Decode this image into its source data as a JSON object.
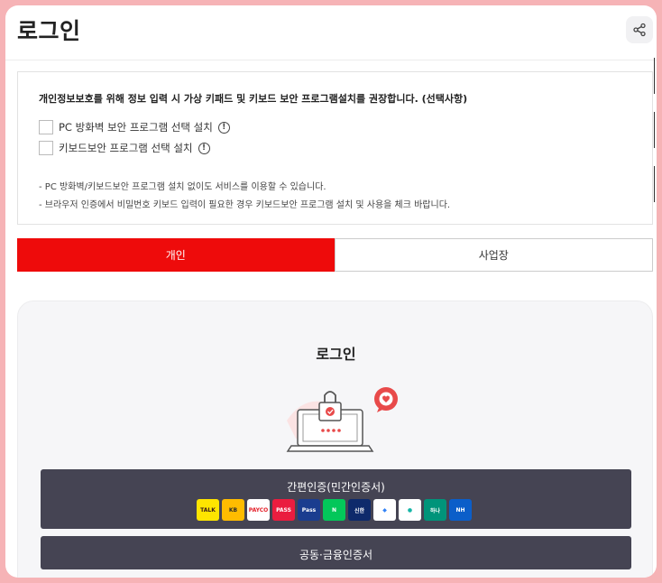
{
  "header": {
    "title": "로그인",
    "share_icon": "share-icon"
  },
  "security_notice": {
    "title": "개인정보보호를 위해 정보 입력 시 가상 키패드 및 키보드 보안 프로그램설치를 권장합니다. (선택사항)",
    "options": [
      {
        "label": "PC 방화벽 보안 프로그램 선택 설치",
        "checked": false
      },
      {
        "label": "키보드보안 프로그램 선택 설치",
        "checked": false
      }
    ],
    "notes": [
      "- PC 방화벽/키보드보안 프로그램 설치 없이도 서비스를 이용할 수 있습니다.",
      "- 브라우저 인증에서 비밀번호 키보드 입력이 필요한 경우 키보드보안 프로그램 설치 및 사용을 체크 바랍니다."
    ],
    "info_icon_glyph": "!"
  },
  "tabs": [
    {
      "label": "개인",
      "active": true
    },
    {
      "label": "사업장",
      "active": false
    }
  ],
  "login_panel": {
    "title": "로그인",
    "illustration": "laptop-lock-icon",
    "simple_auth_label": "간편인증(민간인증서)",
    "cert_login_label": "공동·금융인증서",
    "providers": [
      {
        "name": "kakao",
        "text": "TALK",
        "bg": "#fee500",
        "fg": "#3a1d1d"
      },
      {
        "name": "kb",
        "text": "KB",
        "bg": "#ffbc00",
        "fg": "#2b2b2b"
      },
      {
        "name": "payco",
        "text": "PAYCO",
        "bg": "#ffffff",
        "fg": "#e4212b"
      },
      {
        "name": "pass",
        "text": "PASS",
        "bg": "#ea1d3f",
        "fg": "#ffffff"
      },
      {
        "name": "samsung-pass",
        "text": "Pass",
        "bg": "#1a3d8f",
        "fg": "#ffffff"
      },
      {
        "name": "naver",
        "text": "N",
        "bg": "#03c75a",
        "fg": "#ffffff"
      },
      {
        "name": "shinhan",
        "text": "신한",
        "bg": "#0e2a6b",
        "fg": "#ffffff"
      },
      {
        "name": "toss",
        "text": "◆",
        "bg": "#ffffff",
        "fg": "#3182f6"
      },
      {
        "name": "bank-salad",
        "text": "●",
        "bg": "#ffffff",
        "fg": "#16b5a6"
      },
      {
        "name": "hana",
        "text": "하나",
        "bg": "#00947a",
        "fg": "#ffffff"
      },
      {
        "name": "nh",
        "text": "NH",
        "bg": "#0b5ec9",
        "fg": "#ffffff"
      }
    ]
  },
  "colors": {
    "accent": "#ee0b0b",
    "button_dark": "#454453",
    "border_pink": "#f6b3b6"
  }
}
